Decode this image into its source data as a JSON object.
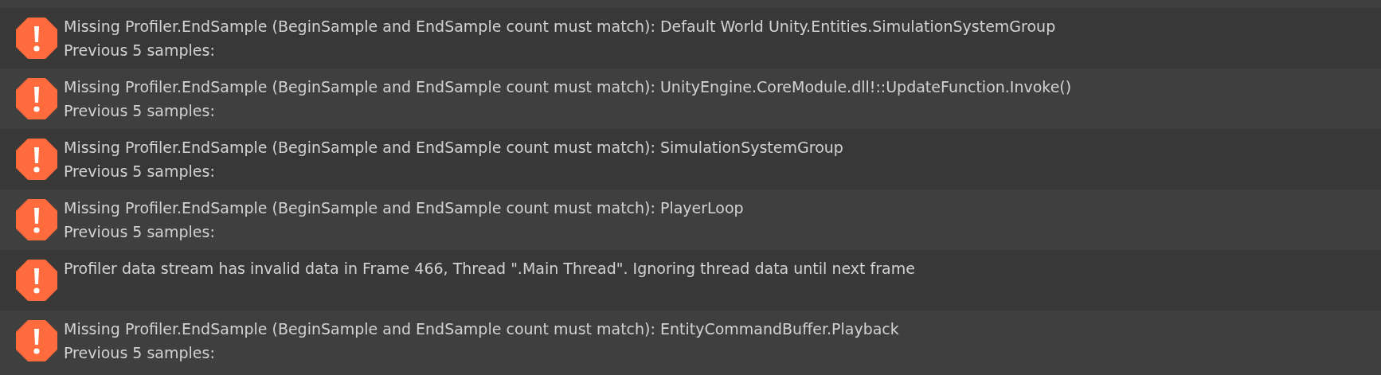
{
  "console": {
    "entries": [
      {
        "kind": "error",
        "message": "Missing Profiler.EndSample (BeginSample and EndSample count must match): Default World Unity.Entities.SimulationSystemGroup",
        "detail": "Previous 5 samples:"
      },
      {
        "kind": "error",
        "message": "Missing Profiler.EndSample (BeginSample and EndSample count must match): UnityEngine.CoreModule.dll!::UpdateFunction.Invoke()",
        "detail": "Previous 5 samples:"
      },
      {
        "kind": "error",
        "message": "Missing Profiler.EndSample (BeginSample and EndSample count must match): SimulationSystemGroup",
        "detail": "Previous 5 samples:"
      },
      {
        "kind": "error",
        "message": "Missing Profiler.EndSample (BeginSample and EndSample count must match): PlayerLoop",
        "detail": "Previous 5 samples:"
      },
      {
        "kind": "error",
        "message": "Profiler data stream has invalid data in Frame 466, Thread \".Main Thread\". Ignoring thread data until next frame"
      },
      {
        "kind": "error",
        "message": "Missing Profiler.EndSample (BeginSample and EndSample count must match): EntityCommandBuffer.Playback",
        "detail": "Previous 5 samples:"
      }
    ]
  }
}
